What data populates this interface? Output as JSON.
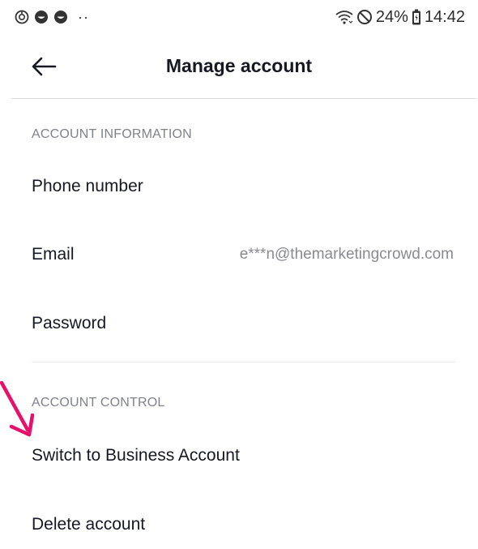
{
  "status_bar": {
    "battery": "24%",
    "time": "14:42"
  },
  "header": {
    "title": "Manage account"
  },
  "sections": [
    {
      "title": "ACCOUNT INFORMATION",
      "rows": [
        {
          "label": "Phone number",
          "value": ""
        },
        {
          "label": "Email",
          "value": "e***n@themarketingcrowd.com"
        },
        {
          "label": "Password",
          "value": ""
        }
      ]
    },
    {
      "title": "ACCOUNT CONTROL",
      "rows": [
        {
          "label": "Switch to Business Account"
        },
        {
          "label": "Delete account"
        }
      ]
    }
  ],
  "colors": {
    "accent_arrow": "#e8106a",
    "section_header": "#80828a",
    "primary_text": "#161823",
    "secondary_text": "#8a8b91"
  }
}
